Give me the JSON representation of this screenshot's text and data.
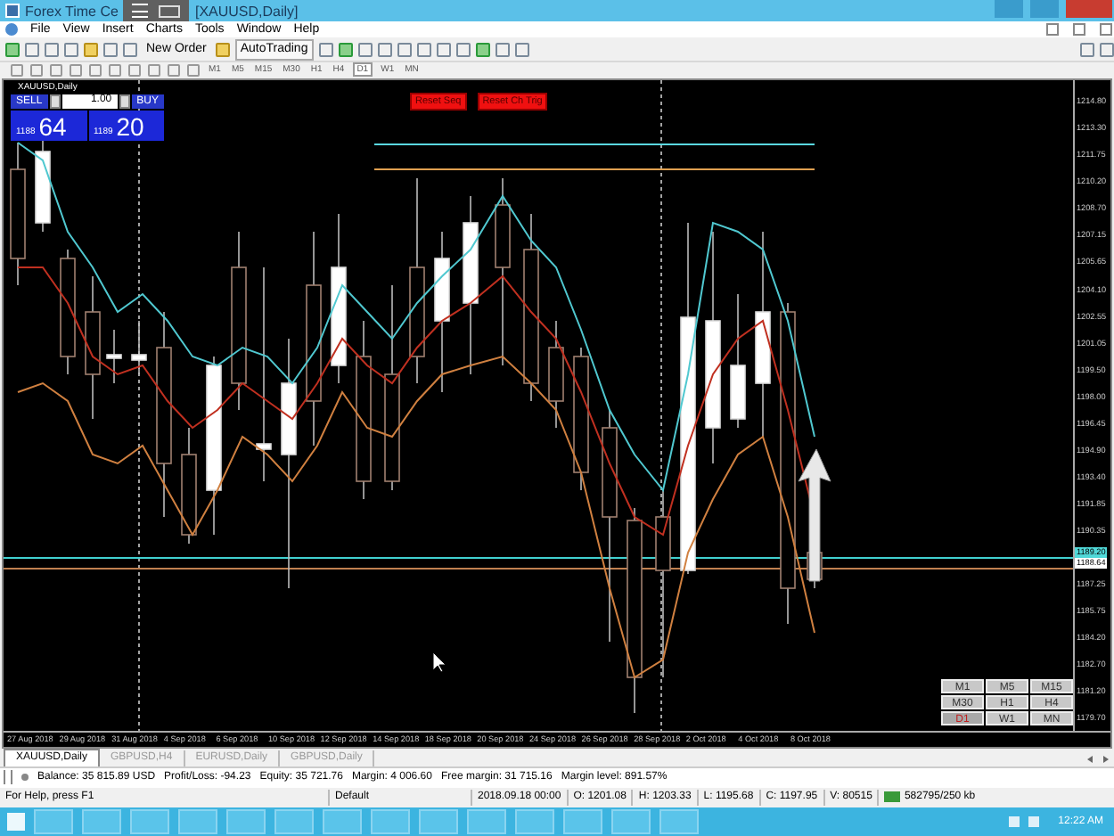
{
  "window": {
    "title_parts": [
      "Forex Time Ce",
      "[XAUUSD,Daily]"
    ]
  },
  "menu": [
    "File",
    "View",
    "Insert",
    "Charts",
    "Tools",
    "Window",
    "Help"
  ],
  "toolbar": {
    "new_order": "New Order",
    "auto_trading": "AutoTrading"
  },
  "timeframe_toolbar": [
    {
      "label": "M1",
      "selected": false
    },
    {
      "label": "M5",
      "selected": false
    },
    {
      "label": "M15",
      "selected": false
    },
    {
      "label": "M30",
      "selected": false
    },
    {
      "label": "H1",
      "selected": false
    },
    {
      "label": "H4",
      "selected": false
    },
    {
      "label": "D1",
      "selected": true
    },
    {
      "label": "W1",
      "selected": false
    },
    {
      "label": "MN",
      "selected": false
    }
  ],
  "chart": {
    "symbol": "XAUUSD,Daily",
    "trade_panel": {
      "sell": "SELL",
      "buy": "BUY",
      "lot": "1.00",
      "sell_small": "1188",
      "sell_big": "64",
      "buy_small": "1189",
      "buy_big": "20"
    },
    "buttons": [
      "Reset Seq",
      "Reset Ch Trig"
    ],
    "price_ticks_above": [
      "1214.80",
      "1213.30",
      "1211.75",
      "1210.20",
      "1208.70",
      "1207.15",
      "1205.65",
      "1204.10",
      "1202.55",
      "1201.05",
      "1199.50",
      "1198.00",
      "1196.45",
      "1194.90",
      "1193.40",
      "1191.85",
      "1190.35"
    ],
    "ask_marker": "1189.20",
    "bid_marker": "1188.64",
    "price_ticks_below": [
      "1187.25",
      "1185.75",
      "1184.20",
      "1182.70",
      "1181.20",
      "1179.70"
    ],
    "dates": [
      "27 Aug 2018",
      "29 Aug 2018",
      "31 Aug 2018",
      "4 Sep 2018",
      "6 Sep 2018",
      "10 Sep 2018",
      "12 Sep 2018",
      "14 Sep 2018",
      "18 Sep 2018",
      "20 Sep 2018",
      "24 Sep 2018",
      "26 Sep 2018",
      "28 Sep 2018",
      "2 Oct 2018",
      "4 Oct 2018",
      "8 Oct 2018"
    ],
    "period_buttons": [
      {
        "label": "M1",
        "selected": false
      },
      {
        "label": "M5",
        "selected": false
      },
      {
        "label": "M15",
        "selected": false
      },
      {
        "label": "M30",
        "selected": false
      },
      {
        "label": "H1",
        "selected": false
      },
      {
        "label": "H4",
        "selected": false
      },
      {
        "label": "D1",
        "selected": true
      },
      {
        "label": "W1",
        "selected": false
      },
      {
        "label": "MN",
        "selected": false
      }
    ]
  },
  "chart_tabs": [
    {
      "label": "XAUUSD,Daily",
      "selected": true
    },
    {
      "label": "GBPUSD,H4",
      "selected": false
    },
    {
      "label": "EURUSD,Daily",
      "selected": false
    },
    {
      "label": "GBPUSD,Daily",
      "selected": false
    }
  ],
  "account": [
    "Balance: 35 815.89 USD",
    "Profit/Loss: -94.23",
    "Equity: 35 721.76",
    "Margin: 4 006.60",
    "Free margin: 31 715.16",
    "Margin level: 891.57%"
  ],
  "status_bar": [
    "For Help, press F1",
    "Default",
    "2018.09.18 00:00",
    "O: 1201.08",
    "H: 1203.33",
    "L: 1195.68",
    "C: 1197.95",
    "V: 80515",
    "582795/250 kb"
  ],
  "taskbar": {
    "clock": "12:22 AM"
  }
}
